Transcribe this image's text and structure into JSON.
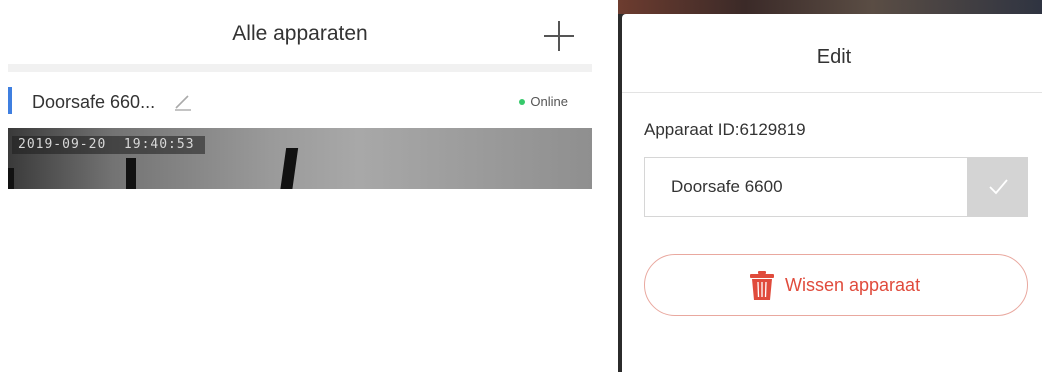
{
  "device_list": {
    "title": "Alle apparaten",
    "add_icon": "plus-icon",
    "device": {
      "name": "Doorsafe 660...",
      "status": "Online",
      "status_color": "#36c96b",
      "accent_color": "#3f7fe0",
      "edit_icon": "pencil-icon"
    },
    "camera_timestamp": "2019-09-20  19:40:53"
  },
  "edit_dialog": {
    "title": "Edit",
    "device_id": "Apparaat ID:6129819",
    "name_value": "Doorsafe 6600",
    "confirm_icon": "checkmark-icon",
    "delete_label": "Wissen apparaat",
    "delete_icon": "trash-icon",
    "delete_color": "#e04b3c"
  }
}
